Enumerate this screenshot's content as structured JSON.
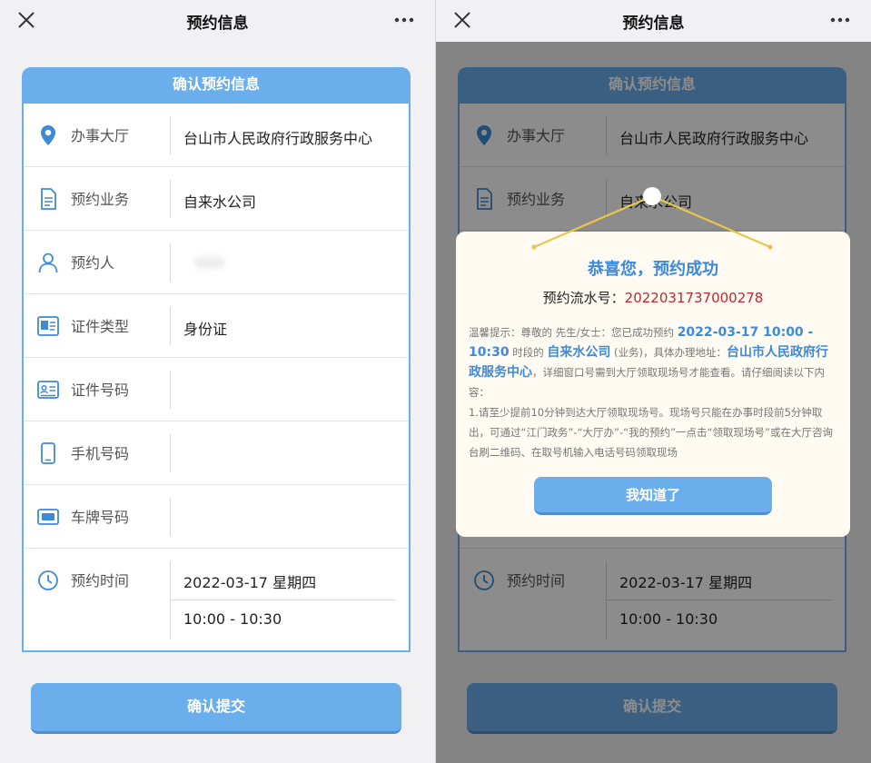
{
  "nav": {
    "title": "预约信息"
  },
  "card": {
    "header": "确认预约信息"
  },
  "rows": [
    {
      "icon": "location-pin-icon",
      "label": "办事大厅",
      "value": "台山市人民政府行政服务中心"
    },
    {
      "icon": "document-icon",
      "label": "预约业务",
      "value": "自来水公司"
    },
    {
      "icon": "person-icon",
      "label": "预约人",
      "value": ""
    },
    {
      "icon": "id-card-icon",
      "label": "证件类型",
      "value": "身份证"
    },
    {
      "icon": "id-number-icon",
      "label": "证件号码",
      "value": ""
    },
    {
      "icon": "phone-icon",
      "label": "手机号码",
      "value": ""
    },
    {
      "icon": "license-plate-icon",
      "label": "车牌号码",
      "value": ""
    }
  ],
  "time": {
    "icon": "clock-icon",
    "label": "预约时间",
    "date": "2022-03-17  星期四",
    "slot": "10:00 - 10:30"
  },
  "submit_label": "确认提交",
  "modal": {
    "title": "恭喜您，预约成功",
    "serial_label": "预约流水号：",
    "serial_value": "2022031737000278",
    "notice_1": "温馨提示：尊敬的        先生/女士：您已成功预约 ",
    "notice_date": "2022-03-17   10:00 - 10:30",
    "notice_2": " 时段的 ",
    "notice_business": "自来水公司",
    "notice_3": " (业务)，具体办理地址：",
    "notice_address": "台山市人民政府行政服务中心",
    "notice_4": "，详细窗口号需到大厅领取现场号才能查看。请仔细阅读以下内容：",
    "notice_5": "1.请至少提前10分钟到达大厅领取现场号。现场号只能在办事时段前5分钟取出，可通过“江门政务”-“大厅办”-“我的预约”一点击“领取现场号”或在大厅咨询台刷二维码、在取号机输入电话号码领取现场",
    "ok_label": "我知道了"
  }
}
